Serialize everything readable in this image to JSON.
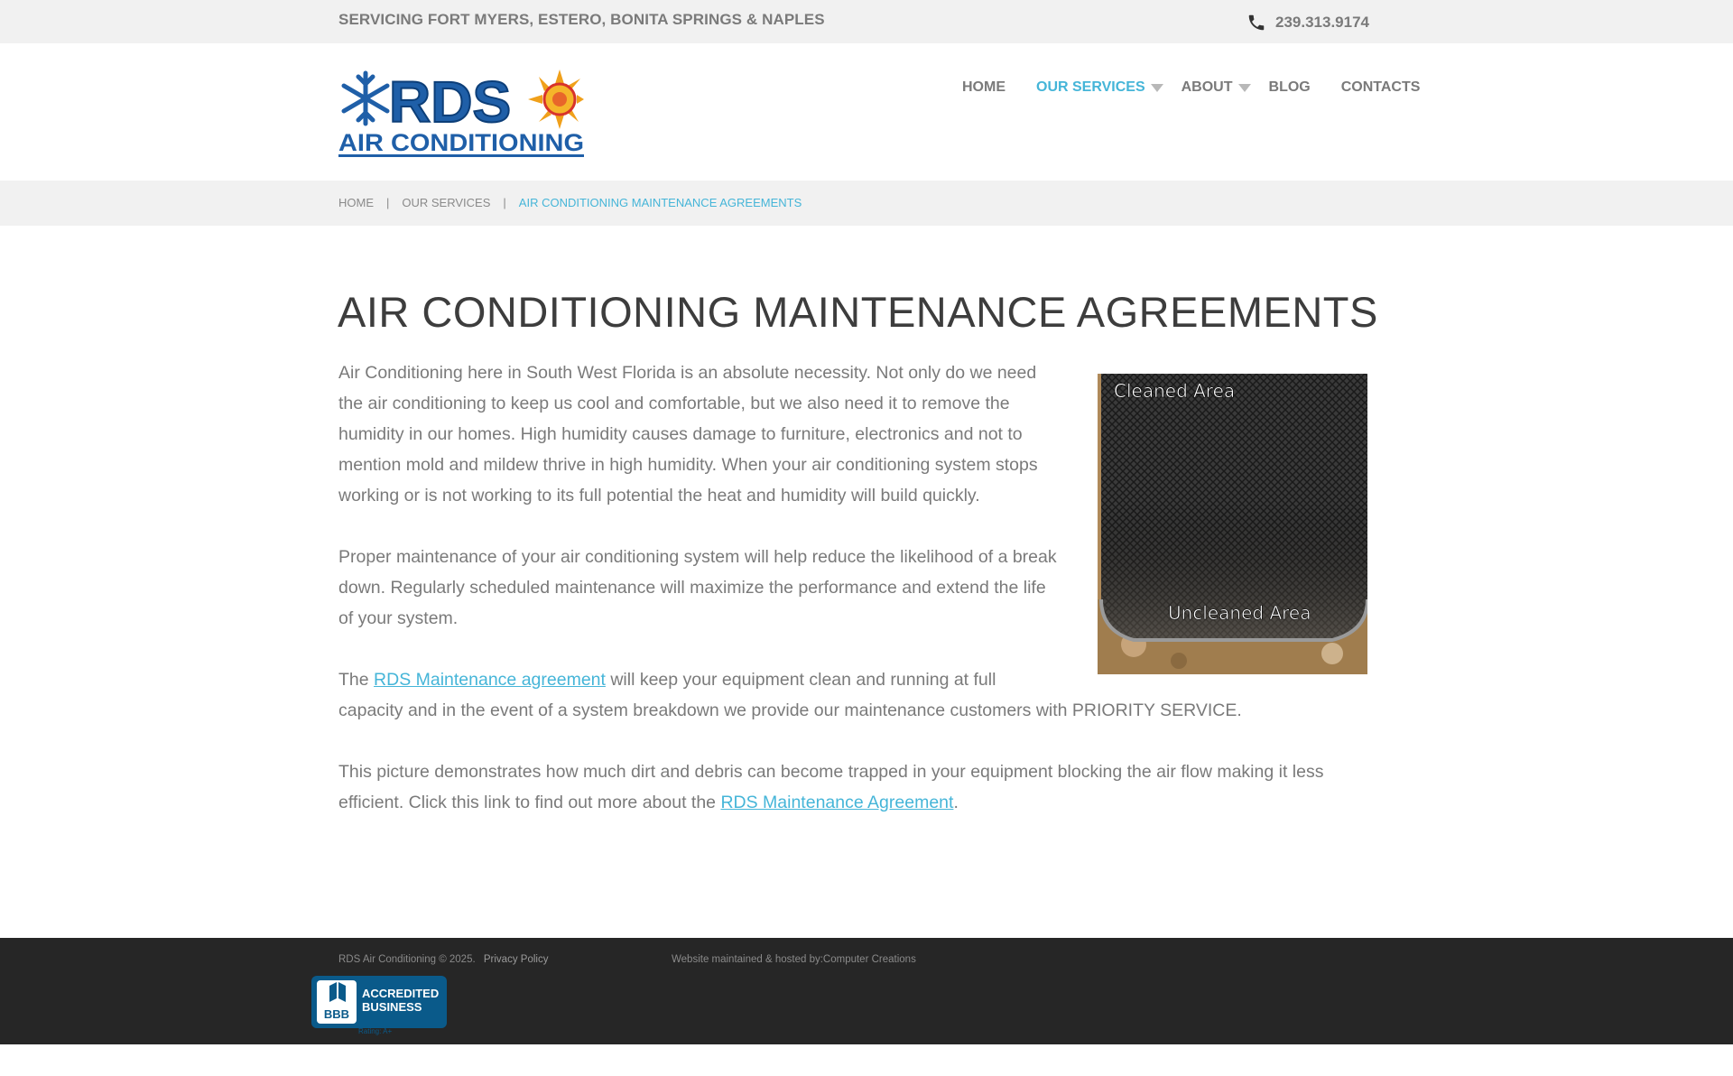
{
  "topbar": {
    "service_area": "SERVICING FORT MYERS, ESTERO, BONITA SPRINGS & NAPLES",
    "phone": "239.313.9174",
    "phone_icon": "phone-icon"
  },
  "logo": {
    "brand": "RDS",
    "tagline": "AIR CONDITIONING",
    "icons": [
      "snowflake-icon",
      "sun-icon"
    ],
    "colors": {
      "blue": "#1f5fa8",
      "orange": "#f0a01a",
      "red": "#d8332a"
    }
  },
  "nav": {
    "items": [
      {
        "label": "HOME"
      },
      {
        "label": "OUR SERVICES"
      },
      {
        "label": "ABOUT"
      },
      {
        "label": "BLOG"
      },
      {
        "label": "CONTACTS"
      }
    ],
    "active_color": "#45b5d8"
  },
  "breadcrumb": {
    "home": "HOME",
    "section": "OUR SERVICES",
    "current": "AIR CONDITIONING MAINTENANCE AGREEMENTS",
    "separator": "|"
  },
  "page": {
    "title": "AIR CONDITIONING MAINTENANCE AGREEMENTS",
    "paragraph_1": "Air Conditioning here in South West Florida is an absolute necessity. Not only do we need the air conditioning to keep us cool and comfortable, but we also need it to remove the humidity in our homes. High humidity causes damage to furniture, electronics and not to mention mold and mildew thrive in high humidity. When your air conditioning system stops working or is not working to its full potential the heat and humidity will build quickly.",
    "paragraph_2": "Proper maintenance of your air conditioning system will help reduce the likelihood of a break down. Regularly scheduled maintenance will maximize the performance and extend the life of your system.",
    "paragraph_3_prefix": "The ",
    "paragraph_3_link": "RDS Maintenance agreement",
    "paragraph_3_suffix": " will keep your equipment clean and running at full capacity and in the event of a system breakdown we provide our maintenance customers with PRIORITY SERVICE.",
    "paragraph_4_prefix": "This picture demonstrates how much dirt and debris can become trapped in your equipment blocking the air flow making it less efficient. Click this link to find out more about the ",
    "paragraph_4_link": "RDS Maintenance Agreement",
    "paragraph_4_suffix": ".",
    "photo": {
      "label_top": "Cleaned Area",
      "label_bottom": "Uncleaned Area"
    }
  },
  "footer": {
    "copyright": "RDS Air Conditioning © 2025.",
    "privacy": "Privacy Policy",
    "maintained": "Website maintained & hosted by:Computer Creations",
    "bbb": {
      "mark": "BBB",
      "line1": "ACCREDITED",
      "line2": "BUSINESS",
      "rating": "Rating: A+"
    }
  }
}
